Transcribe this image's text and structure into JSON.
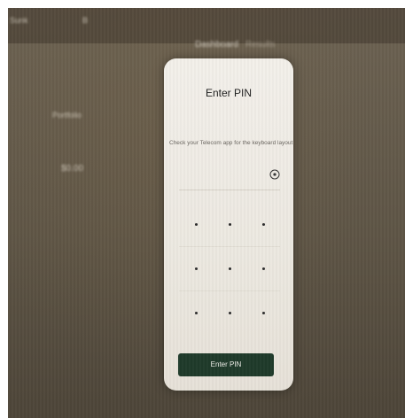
{
  "background": {
    "topbar_left": "Sunk",
    "topbar_right": "B",
    "tab_active": "Dashboard",
    "tab_inactive": "Results",
    "sidebar_label": "Portfolio",
    "sidebar_value": "$0.00"
  },
  "modal": {
    "title": "Enter PIN",
    "instructions": "Check your Telecom app for the keyboard layout",
    "eye_icon": "eye-icon",
    "keypad_rows": 3,
    "keypad_cols": 3,
    "submit_label": "Enter PIN"
  },
  "colors": {
    "button": "#1f3a2a",
    "modal_bg": "#efebe4"
  }
}
